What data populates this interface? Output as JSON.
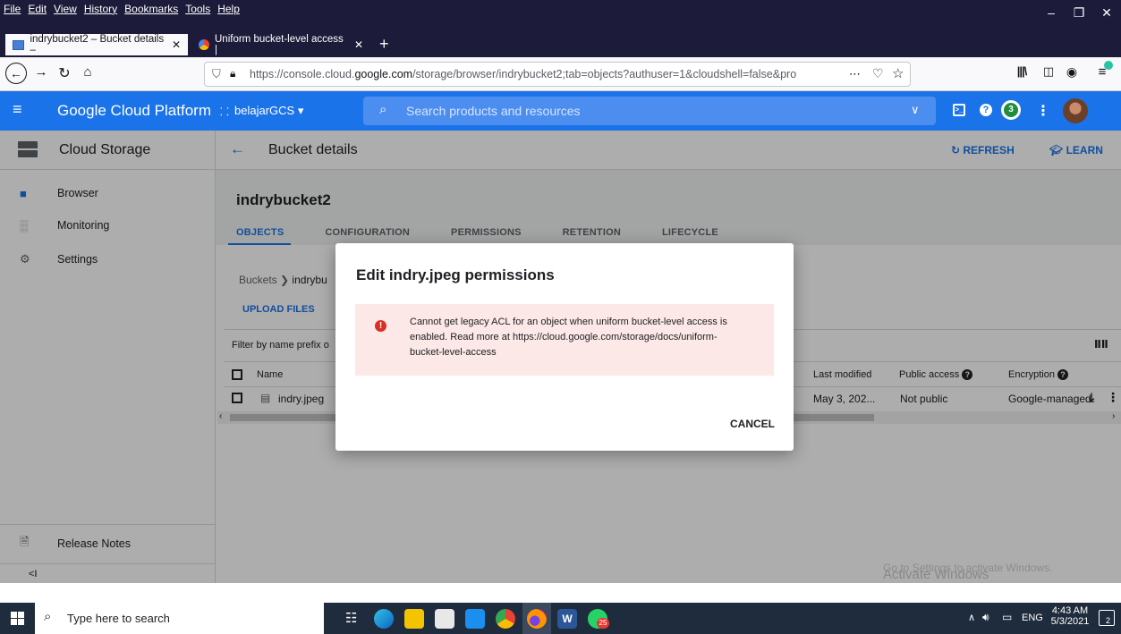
{
  "browser": {
    "menu": [
      "File",
      "Edit",
      "View",
      "History",
      "Bookmarks",
      "Tools",
      "Help"
    ],
    "tabs": [
      {
        "title": "indrybucket2 – Bucket details –"
      },
      {
        "title": "Uniform bucket-level access |"
      }
    ],
    "url_prefix": "https://console.cloud.",
    "url_domain": "google.com",
    "url_rest": "/storage/browser/indrybucket2;tab=objects?authuser=1&cloudshell=false&pro",
    "url_more": "⋯"
  },
  "gcp": {
    "product_title": "Google Cloud Platform",
    "project": "belajarGCS",
    "search_placeholder": "Search products and resources",
    "notif_count": "3"
  },
  "sidebar": {
    "title": "Cloud Storage",
    "items": [
      {
        "label": "Browser"
      },
      {
        "label": "Monitoring"
      },
      {
        "label": "Settings"
      }
    ],
    "release_notes": "Release Notes",
    "collapse": "<I"
  },
  "main": {
    "header_title": "Bucket details",
    "refresh": "REFRESH",
    "learn": "LEARN",
    "bucket_name": "indrybucket2",
    "tabs": [
      "OBJECTS",
      "CONFIGURATION",
      "PERMISSIONS",
      "RETENTION",
      "LIFECYCLE"
    ],
    "breadcrumb_root": "Buckets",
    "breadcrumb_current": "indrybu",
    "upload_files": "UPLOAD FILES",
    "filter_text": "Filter by name prefix o",
    "columns": {
      "name": "Name",
      "last_modified": "Last modified",
      "public_access": "Public access",
      "encryption": "Encryption"
    },
    "rows": [
      {
        "name": "indry.jpeg",
        "last_modified": "May 3, 202...",
        "public_access": "Not public",
        "encryption": "Google-managed"
      }
    ]
  },
  "dialog": {
    "title": "Edit indry.jpeg permissions",
    "error_line1": "Cannot get legacy ACL for an object when uniform bucket-level access is",
    "error_line2": "enabled. Read more at https://cloud.google.com/storage/docs/uniform-",
    "error_line3": "bucket-level-access",
    "cancel": "CANCEL"
  },
  "watermark": {
    "line1": "Activate Windows",
    "line2": "Go to Settings to activate Windows."
  },
  "taskbar": {
    "search_placeholder": "Type here to search",
    "lang": "ENG",
    "time": "4:43 AM",
    "date": "5/3/2021",
    "whatsapp_badge": "25",
    "notif_badge": "2"
  },
  "colors": {
    "gcp_blue": "#1a73e8",
    "error_red": "#d93025",
    "error_bg": "#fce8e6",
    "taskbar": "#1f2c3d",
    "firefox_dark": "#1c1b3a"
  }
}
